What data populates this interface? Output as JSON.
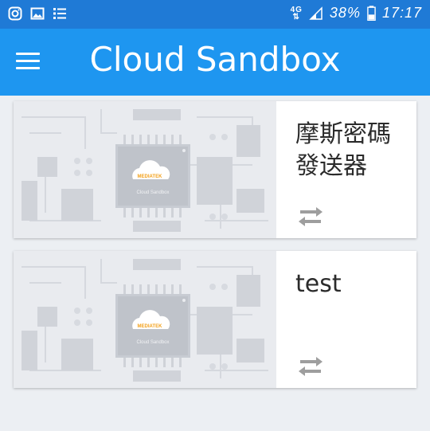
{
  "status_bar": {
    "network": "4G",
    "battery": "38%",
    "time": "17:17",
    "icons": [
      "instagram-icon",
      "image-icon",
      "list-icon",
      "signal-icon",
      "battery-icon"
    ]
  },
  "app_bar": {
    "title": "Cloud Sandbox",
    "menu_icon": "hamburger-menu-icon"
  },
  "cards": [
    {
      "title": "摩斯密碼發送器",
      "logo_text": "MEDIATEK",
      "logo_subtext": "Cloud Sandbox",
      "action_icon": "swap-arrows-icon"
    },
    {
      "title": "test",
      "logo_text": "MEDIATEK",
      "logo_subtext": "Cloud Sandbox",
      "action_icon": "swap-arrows-icon"
    }
  ],
  "colors": {
    "status_bar": "#1f7ad6",
    "app_bar": "#1e96f0",
    "background": "#eceff3",
    "card_image_bg": "#e9ebef",
    "icon_gray": "#9e9e9e"
  }
}
